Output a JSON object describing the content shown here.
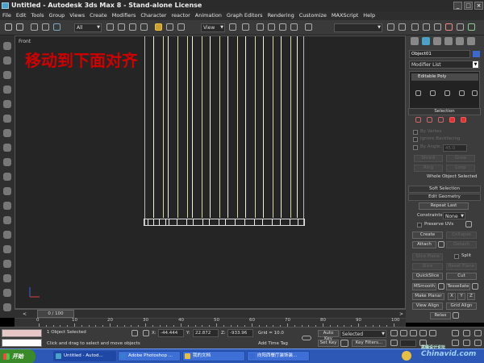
{
  "window": {
    "title": "Untitled - Autodesk 3ds Max 8 - Stand-alone License"
  },
  "menu": [
    "File",
    "Edit",
    "Tools",
    "Group",
    "Views",
    "Create",
    "Modifiers",
    "Character",
    "reactor",
    "Animation",
    "Graph Editors",
    "Rendering",
    "Customize",
    "MAXScript",
    "Help"
  ],
  "toolbar": {
    "filter": "All",
    "view": "View"
  },
  "viewport": {
    "label": "Front",
    "overlay_text": "移动到下面对齐"
  },
  "command_panel": {
    "object_name": "Object01",
    "modifier_list": "Modifier List",
    "stack_item": "Editable Poly",
    "selection": {
      "title": "Selection",
      "by_vertex": "By Vertex",
      "ignore_backfacing": "Ignore Backfacing",
      "by_angle": "By Angle:",
      "angle_value": "45.0",
      "shrink": "Shrink",
      "grow": "Grow",
      "ring": "Ring",
      "loop": "Loop",
      "status": "Whole Object Selected"
    },
    "soft_selection": "Soft Selection",
    "edit_geometry": "Edit Geometry",
    "repeat_last": "Repeat Last",
    "constraints_label": "Constraints:",
    "constraints_value": "None",
    "preserve_uvs": "Preserve UVs",
    "create": "Create",
    "collapse": "Collapse",
    "attach": "Attach",
    "detach": "Detach",
    "slice_plane": "Slice Plane",
    "split": "Split",
    "slice": "Slice",
    "reset_plane": "Reset Plane",
    "quickslice": "QuickSlice",
    "cut": "Cut",
    "msmooth": "MSmooth",
    "tessellate": "Tessellate",
    "make_planar": "Make Planar",
    "x": "X",
    "y": "Y",
    "z": "Z",
    "view_align": "View Align",
    "grid_align": "Grid Align",
    "relax": "Relax"
  },
  "timeline": {
    "frame": "0 / 100",
    "ruler": [
      "0",
      "10",
      "20",
      "30",
      "40",
      "50",
      "60",
      "70",
      "80",
      "90",
      "100"
    ]
  },
  "status": {
    "selection_info": "1 Object Selected",
    "prompt": "Click and drag to select and move objects",
    "x_label": "X:",
    "x_value": "-44.444",
    "y_label": "Y:",
    "y_value": "22.872",
    "z_label": "Z:",
    "z_value": "-933.96",
    "grid": "Grid = 10.0",
    "add_time_tag": "Add Time Tag",
    "auto_key": "Auto Key",
    "set_key": "Set Key",
    "key_selected": "Selected",
    "key_filters": "Key Filters..."
  },
  "taskbar": {
    "start": "开始",
    "items": [
      "Untitled - Autod...",
      "Adobe Photoshop ...",
      "我的文档",
      "向阳西餐厅装饰装..."
    ]
  },
  "watermark": {
    "main": "Chinavid.com",
    "small": "思缘设计论坛"
  }
}
